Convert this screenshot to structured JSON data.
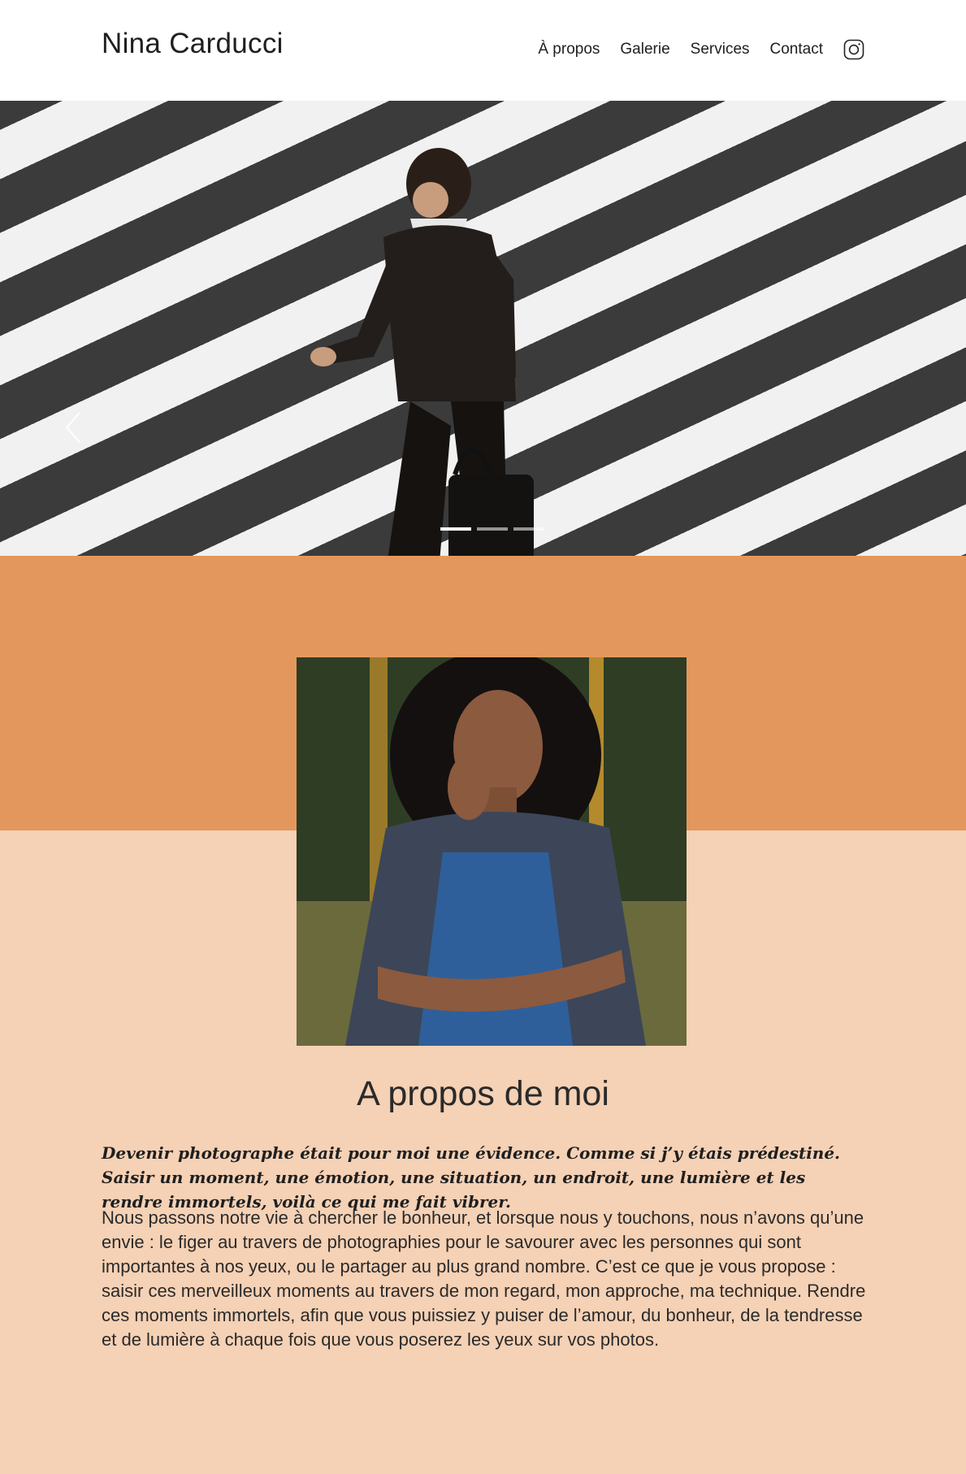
{
  "header": {
    "brand": "Nina Carducci",
    "nav": [
      {
        "label": "À propos"
      },
      {
        "label": "Galerie"
      },
      {
        "label": "Services"
      },
      {
        "label": "Contact"
      }
    ],
    "social_icon": "instagram-icon"
  },
  "hero": {
    "image_subject": "man in suit crossing zebra crosswalk",
    "slide_count": 3,
    "active_slide": 1,
    "prev_icon": "chevron-left-icon"
  },
  "about": {
    "title": "A propos de moi",
    "lead": "Devenir photographe était pour moi une évidence. Comme si j’y étais prédestiné. Saisir un moment, une émotion, une situation, un endroit, une lumière et les rendre immortels, voilà ce qui me fait vibrer.",
    "body": "Nous passons notre vie à chercher le bonheur, et lorsque nous y touchons, nous n’avons qu’une envie : le figer au travers de photographies pour le savourer avec les personnes qui sont importantes à nos yeux, ou le partager au plus grand nombre. C’est ce que je vous propose : saisir ces merveilleux moments au travers de mon regard, mon approche, ma technique. Rendre ces moments immortels, afin que vous puissiez y puiser de l’amour, du bonheur, de la tendresse et de lumière à chaque fois que vous poserez les yeux sur vos photos."
  },
  "colors": {
    "band": "#e4975d",
    "section_bg": "#f5d1b5",
    "text": "#222222"
  }
}
